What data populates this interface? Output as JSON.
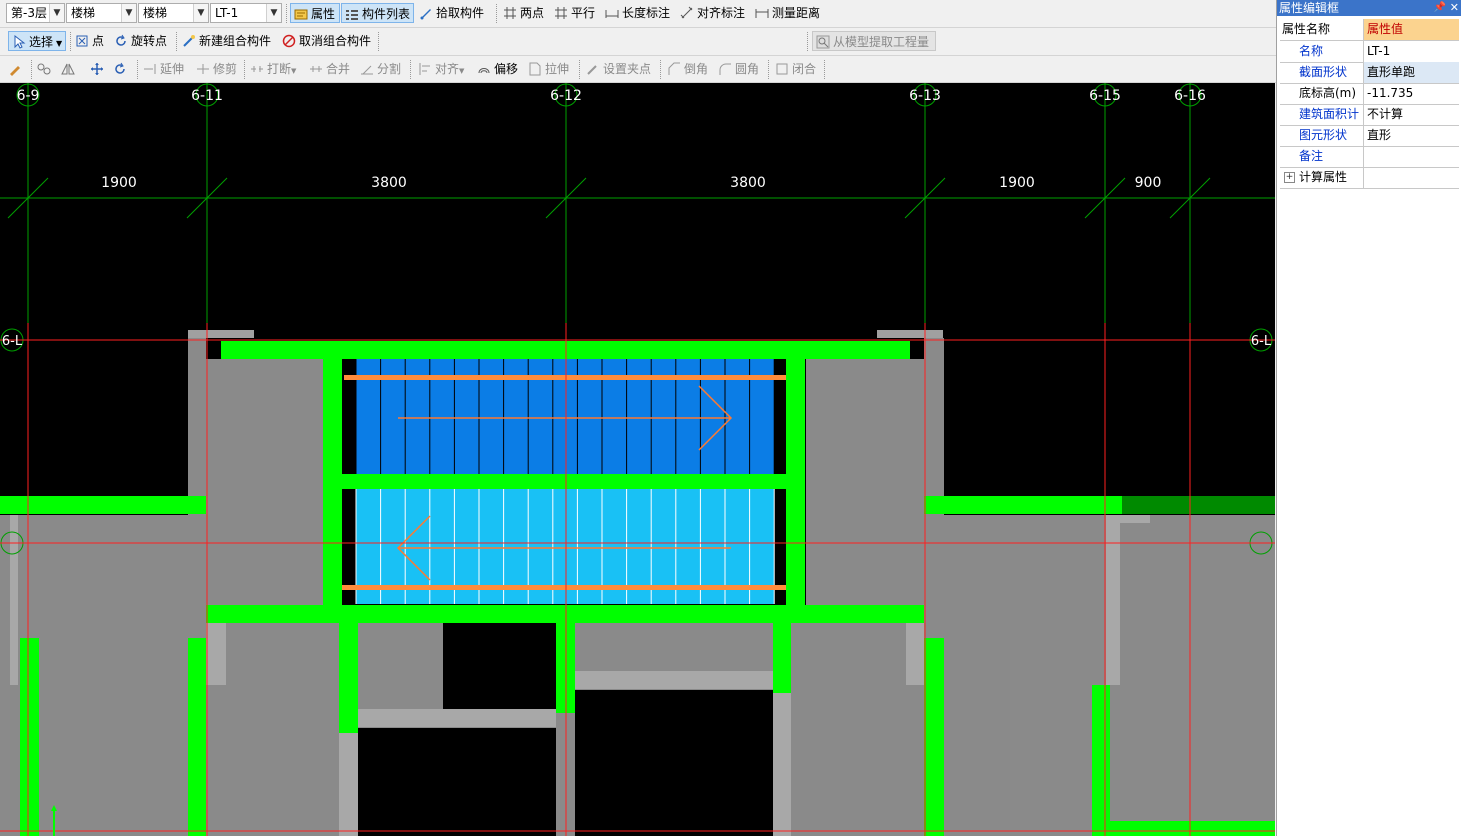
{
  "toolbar1": {
    "floor": "第-3层",
    "category": "楼梯",
    "type": "楼梯",
    "component": "LT-1",
    "properties": "属性",
    "component_list": "构件列表",
    "pick_component": "拾取构件",
    "two_points": "两点",
    "parallel": "平行",
    "length_dim": "长度标注",
    "align_dim": "对齐标注",
    "measure_distance": "测量距离"
  },
  "toolbar2": {
    "select": "选择",
    "point": "点",
    "rotate_point": "旋转点",
    "new_group": "新建组合构件",
    "cancel_group": "取消组合构件",
    "extract_quantity": "从模型提取工程量"
  },
  "toolbar3": {
    "extend": "延伸",
    "trim": "修剪",
    "break": "打断",
    "merge": "合并",
    "split": "分割",
    "align": "对齐",
    "offset": "偏移",
    "stretch": "拉伸",
    "set_grip": "设置夹点",
    "chamfer": "倒角",
    "fillet": "圆角",
    "close": "闭合"
  },
  "canvas": {
    "axes_top": [
      "6-9",
      "6-11",
      "6-12",
      "6-13",
      "6-15",
      "6-16"
    ],
    "dimensions": [
      "1900",
      "3800",
      "3800",
      "1900",
      "900"
    ],
    "axis_side_left": "6-L",
    "axis_side_right": "6-L"
  },
  "panel": {
    "title": "属性编辑框",
    "header_name": "属性名称",
    "header_value": "属性值",
    "rows": [
      {
        "name": "名称",
        "value": "LT-1"
      },
      {
        "name": "截面形状",
        "value": "直形单跑"
      },
      {
        "name": "底标高(m)",
        "value": "-11.735"
      },
      {
        "name": "建筑面积计",
        "value": "不计算"
      },
      {
        "name": "图元形状",
        "value": "直形"
      },
      {
        "name": "备注",
        "value": ""
      },
      {
        "name": "计算属性",
        "value": ""
      }
    ]
  },
  "colors": {
    "wall": "#00ff00",
    "stair_upper": "#0b7de6",
    "stair_lower": "#19c1f5",
    "slab": "#8a8a8a",
    "axis": "#00a000",
    "cut_line": "#ff2020",
    "rail": "#ff8c3c"
  }
}
